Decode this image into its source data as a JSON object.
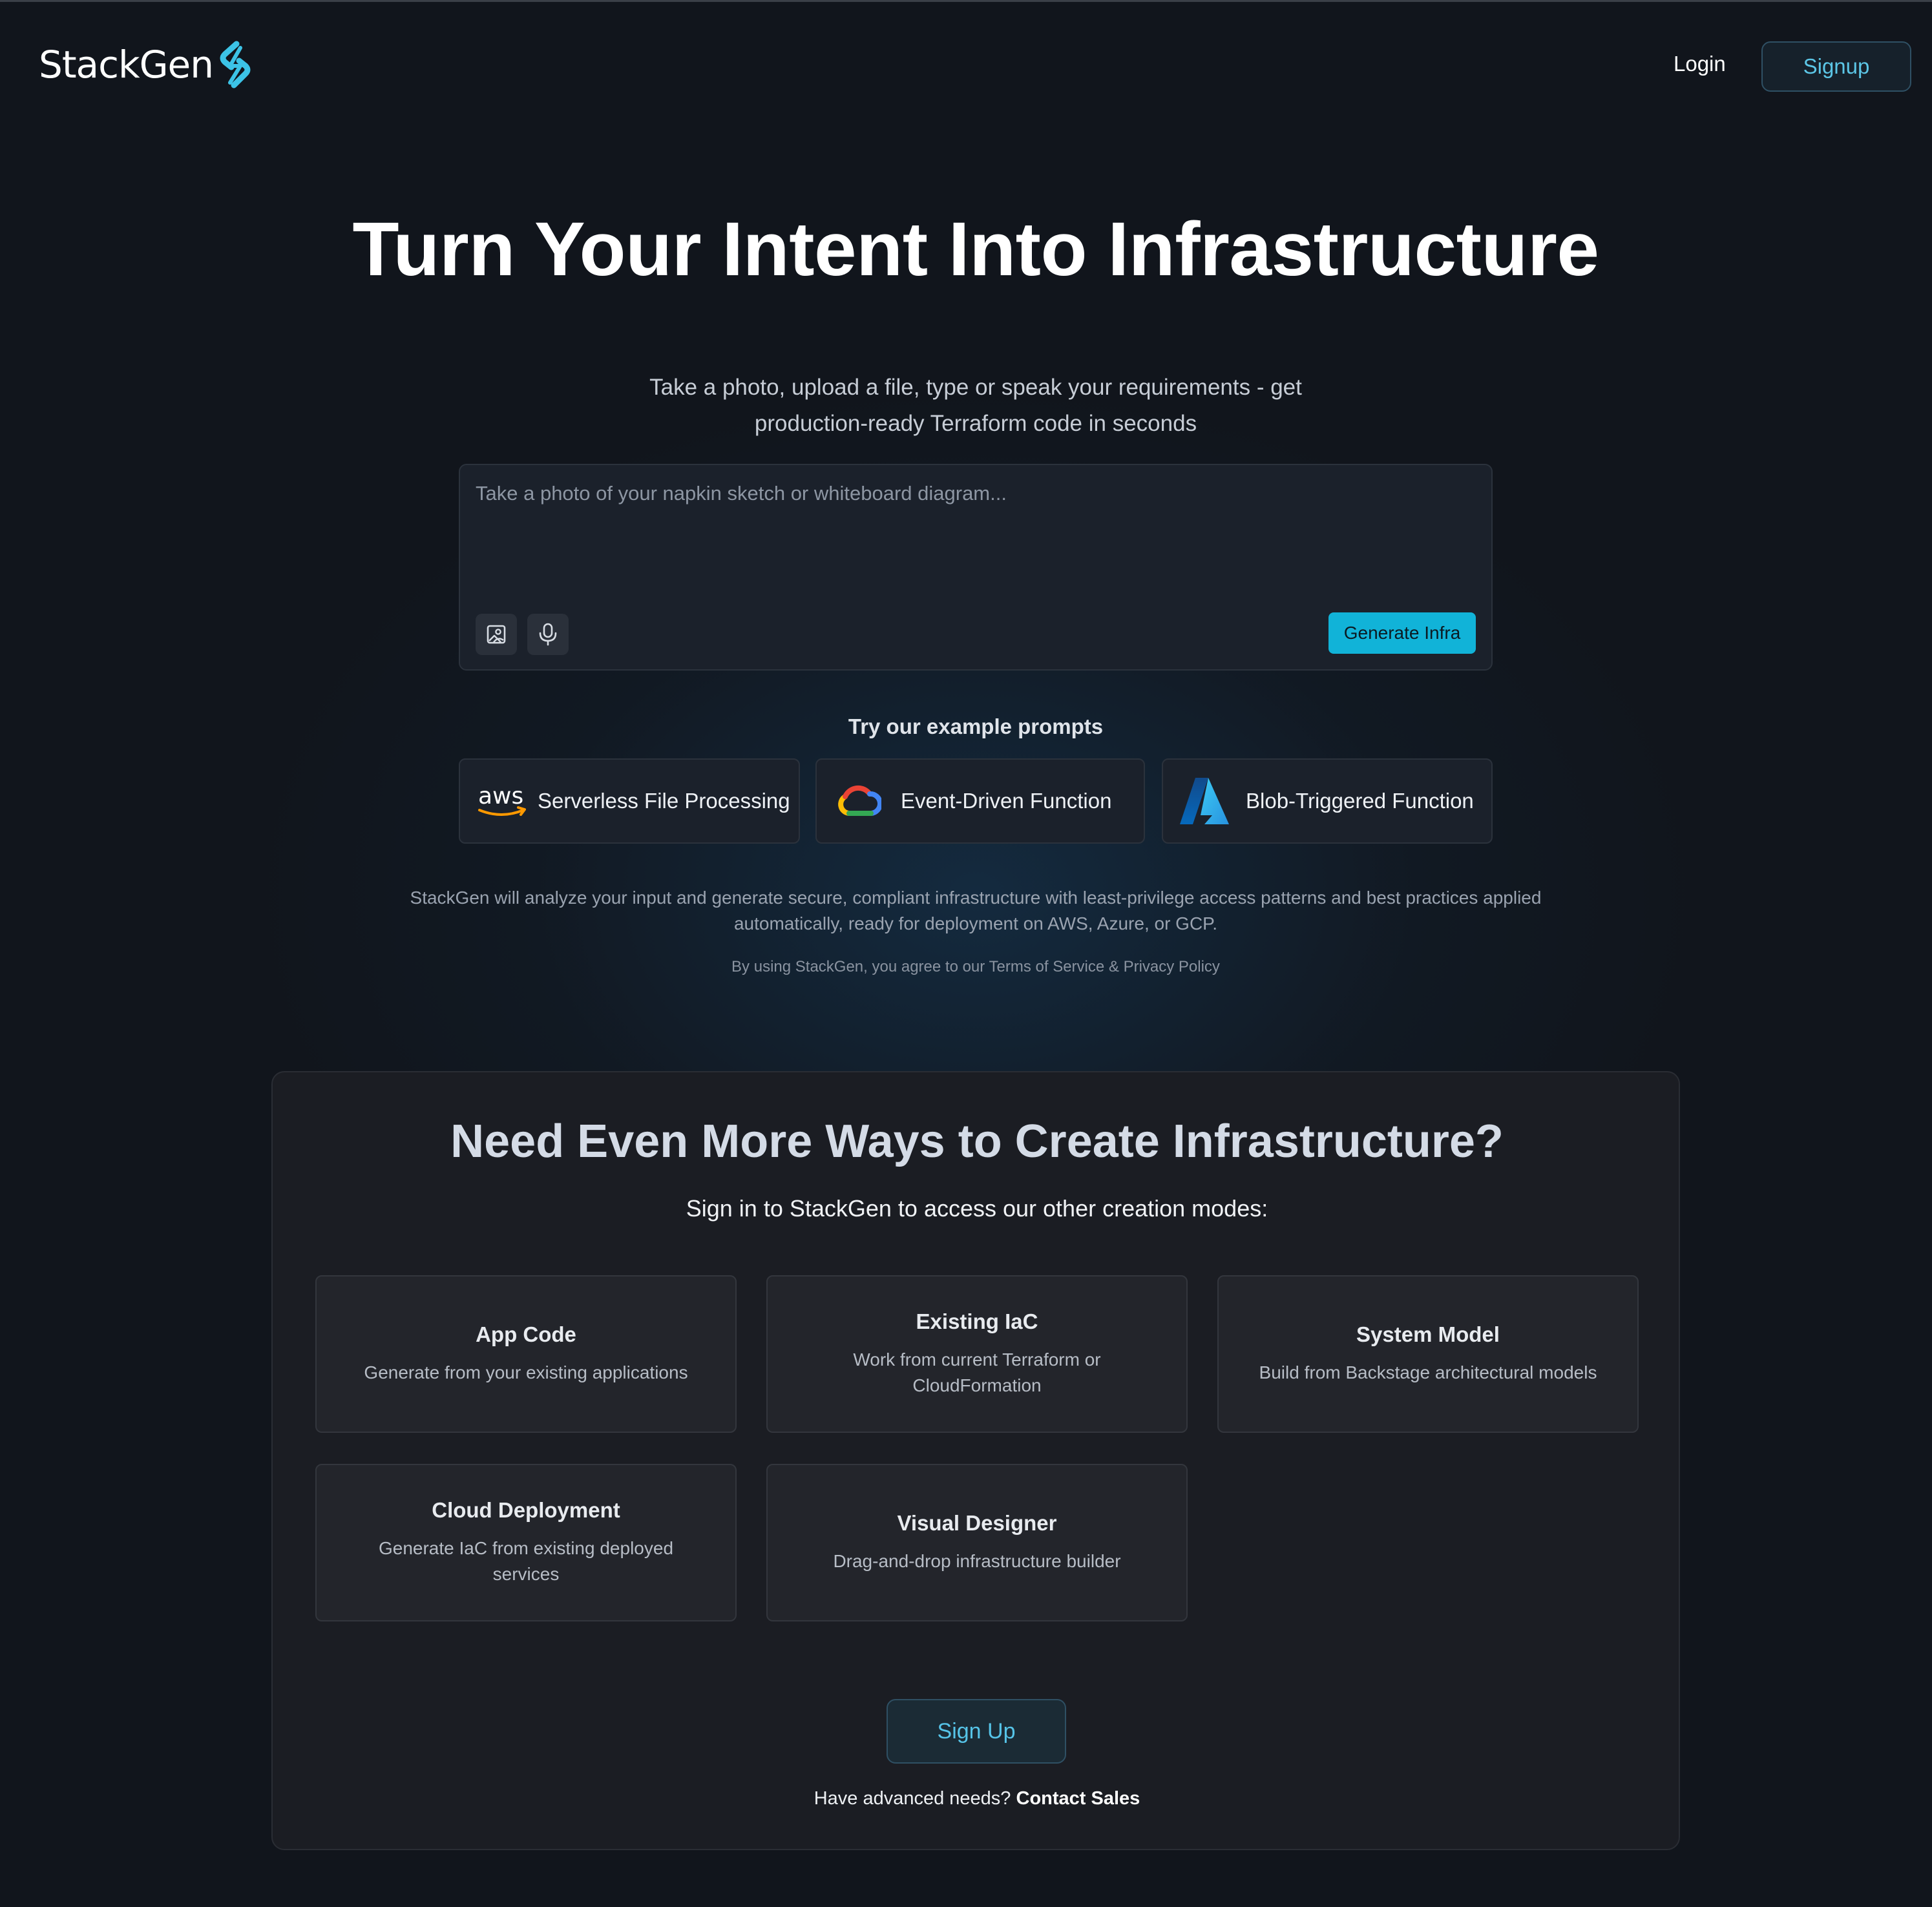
{
  "header": {
    "logo_text": "StackGen",
    "login_label": "Login",
    "signup_label": "Signup"
  },
  "hero": {
    "title": "Turn Your Intent Into Infrastructure",
    "subtitle_line1": "Take a photo, upload a file, type or speak your requirements - get",
    "subtitle_line2": "production-ready Terraform code in seconds"
  },
  "prompt": {
    "placeholder": "Take a photo of your napkin sketch or whiteboard diagram...",
    "value": "",
    "image_button_icon": "image-upload-icon",
    "mic_button_icon": "microphone-icon",
    "generate_label": "Generate Infra"
  },
  "examples": {
    "title": "Try our example prompts",
    "items": [
      {
        "provider_logo": "aws-logo",
        "logo_text": "aws",
        "label": "Serverless File Processing"
      },
      {
        "provider_logo": "google-cloud-logo",
        "label": "Event-Driven Function"
      },
      {
        "provider_logo": "azure-logo",
        "label": "Blob-Triggered Function"
      }
    ]
  },
  "info": {
    "analyze_line1": "StackGen will analyze your input and generate secure, compliant infrastructure with least-privilege access patterns and best practices applied",
    "analyze_line2": "automatically, ready for deployment on AWS, Azure, or GCP.",
    "terms": "By using StackGen, you agree to our Terms of Service & Privacy Policy"
  },
  "more_ways": {
    "title": "Need Even More Ways to Create Infrastructure?",
    "subtitle": "Sign in to StackGen to access our other creation modes:",
    "modes": [
      {
        "title": "App Code",
        "description": "Generate from your existing applications"
      },
      {
        "title": "Existing IaC",
        "description": "Work from current Terraform or CloudFormation"
      },
      {
        "title": "System Model",
        "description": "Build from Backstage architectural models"
      },
      {
        "title": "Cloud Deployment",
        "description": "Generate IaC from existing deployed services"
      },
      {
        "title": "Visual Designer",
        "description": "Drag-and-drop infrastructure builder"
      }
    ],
    "signup_label": "Sign Up",
    "contact_prefix": "Have advanced needs?",
    "contact_sales_label": "Contact Sales"
  },
  "colors": {
    "background": "#11151c",
    "accent": "#11b3d8",
    "link_accent": "#5cc6e6"
  }
}
